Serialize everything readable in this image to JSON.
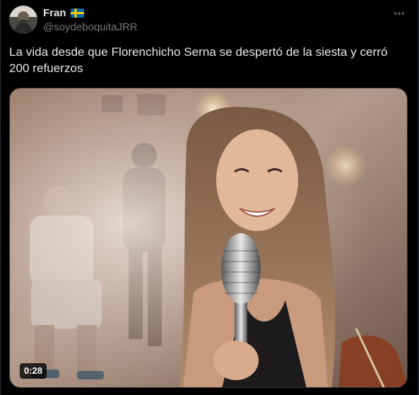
{
  "author": {
    "display_name": "Fran",
    "flag_icon": "sweden-flag-icon",
    "handle": "@soydeboquitaJRR",
    "avatar_icon": "avatar-photo"
  },
  "tweet": {
    "text": "La vida desde que Florenchicho Serna se despertó de la siesta y cerró 200 refuerzos"
  },
  "media": {
    "type": "video",
    "duration": "0:28"
  },
  "icons": {
    "more": "more-options-icon"
  },
  "colors": {
    "background": "#000000",
    "text": "#e7e9ea",
    "secondary_text": "#71767b",
    "border": "#2f3336"
  }
}
